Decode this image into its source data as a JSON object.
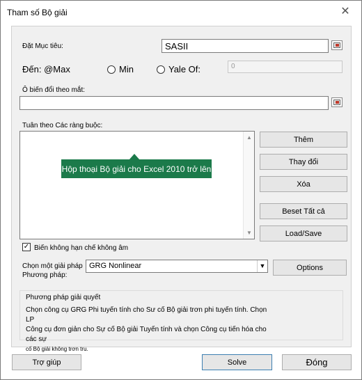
{
  "window": {
    "title": "Tham số Bộ giải",
    "close_symbol": "✕"
  },
  "objective": {
    "label": "Đặt Mục tiêu:",
    "value": "SASII"
  },
  "to": {
    "label": "Đến: @Max",
    "min_label": "Min",
    "value_of_label": "Yale Of:",
    "value_of_field": "0"
  },
  "changing_cells": {
    "label": "Ô biến đổi theo mắt:",
    "value": ""
  },
  "constraints": {
    "label": "Tuân theo Các ràng buộc:",
    "add_label": "Thêm",
    "change_label": "Thay đổi",
    "delete_label": "Xóa",
    "reset_label": "Beset Tất cả",
    "load_save_label": "Load/Save"
  },
  "tooltip": {
    "text": "Hộp thoại Bộ giải cho Excel 2010 trở lên"
  },
  "nonneg": {
    "label": "Biến không hạn chế không âm",
    "checked": true
  },
  "method": {
    "label_line1": "Chọn một giải pháp",
    "label_line2": "Phương pháp:",
    "selected": "GRG Nonlinear",
    "options_label": "Options"
  },
  "solving_method": {
    "title": "Phương pháp giải quyết",
    "line1": "Chọn công cụ GRG Phi tuyến tính cho Sư cố Bộ giải trơn phi tuyến tính. Chọn LP",
    "line2": "Công cụ đơn giản cho Sự cố Bộ giải Tuyến tính và chọn Công cụ tiến hóa cho các sự",
    "line3": "cố Bộ giải không trơn tru."
  },
  "footer": {
    "help_label": "Trợ giúp",
    "solve_label": "Solve",
    "close_label": "Đóng"
  }
}
